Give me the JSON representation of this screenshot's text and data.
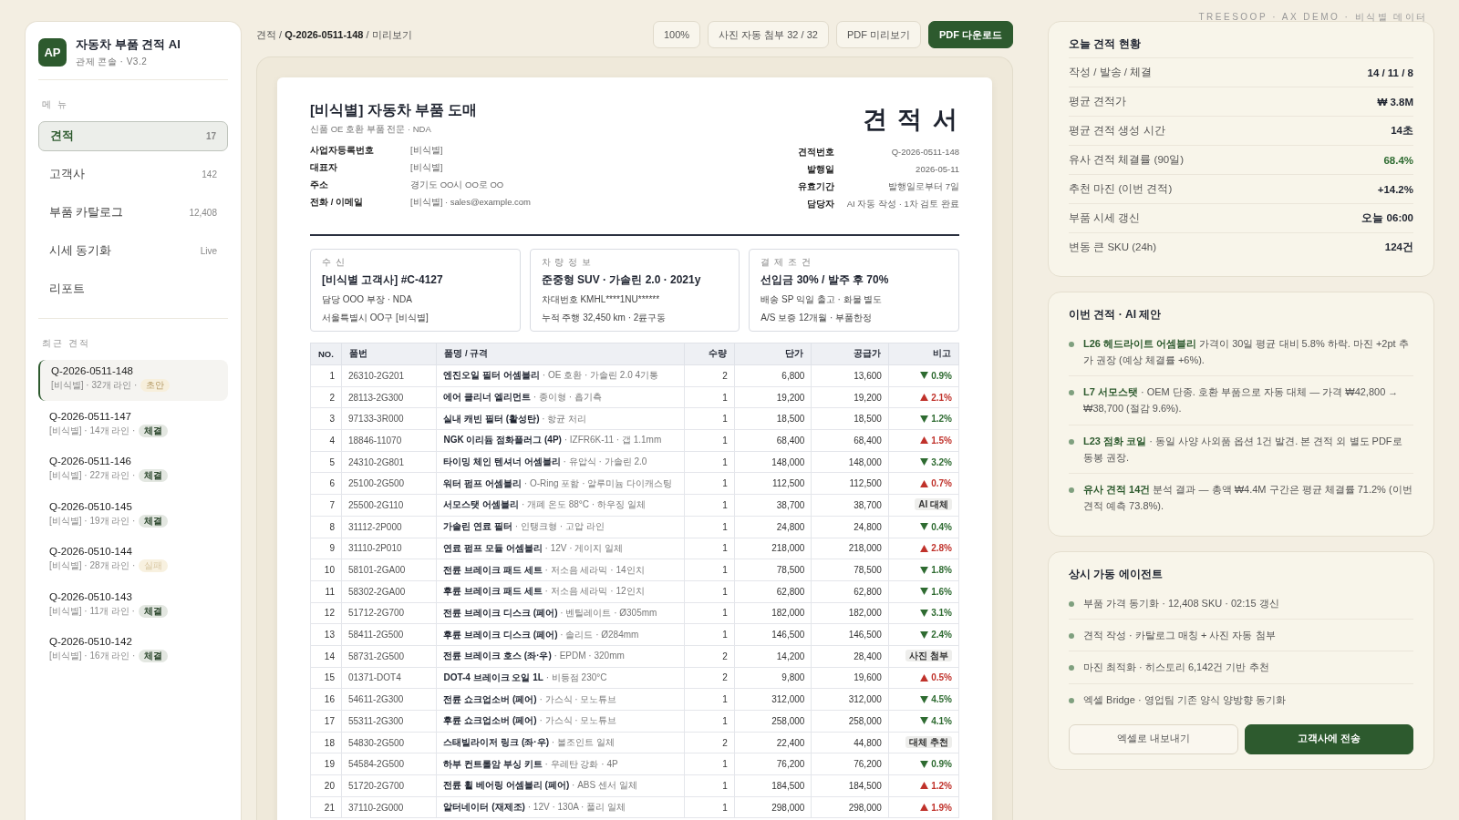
{
  "sidebar": {
    "logo": "AP",
    "app_name": "자동차 부품 견적 AI",
    "subtitle": "관제 콘솔 · V3.2",
    "menu_label": "메 뉴",
    "menu": [
      {
        "label": "견적",
        "count": "17",
        "selected": true
      },
      {
        "label": "고객사",
        "count": "142",
        "selected": false
      },
      {
        "label": "부품 카탈로그",
        "count": "12,408",
        "selected": false
      },
      {
        "label": "시세 동기화",
        "count": "Live",
        "selected": false
      },
      {
        "label": "리포트",
        "selected": false
      }
    ],
    "recent_label": "최근 견적",
    "recent": [
      {
        "id": "Q-2026-0511-148",
        "meta": "[비식별] · 32개 라인 ·",
        "status": "초안",
        "kind": "draft",
        "selected": true
      },
      {
        "id": "Q-2026-0511-147",
        "meta": "[비식별] · 14개 라인 ·",
        "status": "체결",
        "kind": "won",
        "selected": false
      },
      {
        "id": "Q-2026-0511-146",
        "meta": "[비식별] · 22개 라인 ·",
        "status": "체결",
        "kind": "won",
        "selected": false
      },
      {
        "id": "Q-2026-0510-145",
        "meta": "[비식별] · 19개 라인 ·",
        "status": "체결",
        "kind": "won",
        "selected": false
      },
      {
        "id": "Q-2026-0510-144",
        "meta": "[비식별] · 28개 라인 ·",
        "status": "실패",
        "kind": "lost",
        "selected": false
      },
      {
        "id": "Q-2026-0510-143",
        "meta": "[비식별] · 11개 라인 ·",
        "status": "체결",
        "kind": "won",
        "selected": false
      },
      {
        "id": "Q-2026-0510-142",
        "meta": "[비식별] · 16개 라인 ·",
        "status": "체결",
        "kind": "won",
        "selected": false
      }
    ]
  },
  "breadcrumb": "견적 / **Q-2026-0511-148** / 미리보기",
  "toolbar": [
    {
      "label": "100%",
      "kind": "plain"
    },
    {
      "label": "사진 자동 첨부 32 / 32",
      "kind": "plain"
    },
    {
      "label": "PDF 미리보기",
      "kind": "plain"
    },
    {
      "label": "PDF 다운로드",
      "kind": "primary"
    }
  ],
  "document": {
    "company": "[비식별] 자동차 부품 도매",
    "tagline": "신품 OE 호환 부품 전문 · NDA",
    "title": "견 적 서",
    "issuer": [
      {
        "label": "사업자등록번호",
        "value": "[비식별]"
      },
      {
        "label": "대표자",
        "value": "[비식별]"
      },
      {
        "label": "주소",
        "value": "경기도 OO시 OO로 OO"
      },
      {
        "label": "전화 / 이메일",
        "value": "[비식별] · sales@example.com"
      }
    ],
    "meta": [
      {
        "label": "견적번호",
        "value": "Q-2026-0511-148"
      },
      {
        "label": "발행일",
        "value": "2026-05-11"
      },
      {
        "label": "유효기간",
        "value": "발행일로부터 7일"
      },
      {
        "label": "담당자",
        "value": "AI 자동 작성 · 1차 검토 완료"
      }
    ],
    "boxes": [
      {
        "caption": "수 신",
        "lines": [
          "[비식별 고객사] #C-4127",
          "담당 OOO 부장 · NDA",
          "서울특별시 OO구 [비식별]"
        ]
      },
      {
        "caption": "차 량 정 보",
        "lines": [
          "준중형 SUV · 가솔린 2.0 · 2021y",
          "차대번호 KMHL****1NU******",
          "누적 주행 32,450 km · 2륜구동"
        ]
      },
      {
        "caption": "결 제 조 건",
        "lines": [
          "선입금 30% / 발주 후 70%",
          "배송 SP 익일 출고 · 화물 별도",
          "A/S 보증 12개월 · 부품한정"
        ]
      }
    ],
    "table": {
      "columns": [
        "NO.",
        "품번",
        "품명 / 규격",
        "수량",
        "단가",
        "공급가",
        "비고"
      ],
      "rows": [
        {
          "no": "1",
          "part": "26310-2G201",
          "name": "엔진오일 필터 어셈블리",
          "spec": "· OE 호환 · 가솔린 2.0 4기통",
          "qty": "2",
          "unit": "6,800",
          "total": "13,600",
          "note": {
            "kind": "down",
            "text": "0.9%"
          }
        },
        {
          "no": "2",
          "part": "28113-2G300",
          "name": "에어 클리너 엘리먼트",
          "spec": "· 종이형 · 흡기측",
          "qty": "1",
          "unit": "19,200",
          "total": "19,200",
          "note": {
            "kind": "up",
            "text": "2.1%"
          }
        },
        {
          "no": "3",
          "part": "97133-3R000",
          "name": "실내 캐빈 필터 (활성탄)",
          "spec": "· 항균 처리",
          "qty": "1",
          "unit": "18,500",
          "total": "18,500",
          "note": {
            "kind": "down",
            "text": "1.2%"
          }
        },
        {
          "no": "4",
          "part": "18846-11070",
          "name": "NGK 이리듐 점화플러그 (4P)",
          "spec": "· IZFR6K-11 · 갭 1.1mm",
          "qty": "1",
          "unit": "68,400",
          "total": "68,400",
          "note": {
            "kind": "up",
            "text": "1.5%"
          }
        },
        {
          "no": "5",
          "part": "24310-2G801",
          "name": "타이밍 체인 텐셔너 어셈블리",
          "spec": "· 유압식 · 가솔린 2.0",
          "qty": "1",
          "unit": "148,000",
          "total": "148,000",
          "note": {
            "kind": "down",
            "text": "3.2%"
          }
        },
        {
          "no": "6",
          "part": "25100-2G500",
          "name": "워터 펌프 어셈블리",
          "spec": "· O-Ring 포함 · 알루미늄 다이캐스팅",
          "qty": "1",
          "unit": "112,500",
          "total": "112,500",
          "note": {
            "kind": "up",
            "text": "0.7%"
          }
        },
        {
          "no": "7",
          "part": "25500-2G110",
          "name": "서모스탯 어셈블리",
          "spec": "· 개폐 온도 88°C · 하우징 일체",
          "qty": "1",
          "unit": "38,700",
          "total": "38,700",
          "note": {
            "kind": "tag",
            "text": "AI 대체"
          }
        },
        {
          "no": "8",
          "part": "31112-2P000",
          "name": "가솔린 연료 필터",
          "spec": "· 인탱크형 · 고압 라인",
          "qty": "1",
          "unit": "24,800",
          "total": "24,800",
          "note": {
            "kind": "down",
            "text": "0.4%"
          }
        },
        {
          "no": "9",
          "part": "31110-2P010",
          "name": "연료 펌프 모듈 어셈블리",
          "spec": "· 12V · 게이지 일체",
          "qty": "1",
          "unit": "218,000",
          "total": "218,000",
          "note": {
            "kind": "up",
            "text": "2.8%"
          }
        },
        {
          "no": "10",
          "part": "58101-2GA00",
          "name": "전륜 브레이크 패드 세트",
          "spec": "· 저소음 세라믹 · 14인치",
          "qty": "1",
          "unit": "78,500",
          "total": "78,500",
          "note": {
            "kind": "down",
            "text": "1.8%"
          }
        },
        {
          "no": "11",
          "part": "58302-2GA00",
          "name": "후륜 브레이크 패드 세트",
          "spec": "· 저소음 세라믹 · 12인치",
          "qty": "1",
          "unit": "62,800",
          "total": "62,800",
          "note": {
            "kind": "down",
            "text": "1.6%"
          }
        },
        {
          "no": "12",
          "part": "51712-2G700",
          "name": "전륜 브레이크 디스크 (페어)",
          "spec": "· 벤틸레이트 · Ø305mm",
          "qty": "1",
          "unit": "182,000",
          "total": "182,000",
          "note": {
            "kind": "down",
            "text": "3.1%"
          }
        },
        {
          "no": "13",
          "part": "58411-2G500",
          "name": "후륜 브레이크 디스크 (페어)",
          "spec": "· 솔리드 · Ø284mm",
          "qty": "1",
          "unit": "146,500",
          "total": "146,500",
          "note": {
            "kind": "down",
            "text": "2.4%"
          }
        },
        {
          "no": "14",
          "part": "58731-2G500",
          "name": "전륜 브레이크 호스 (좌·우)",
          "spec": "· EPDM · 320mm",
          "qty": "2",
          "unit": "14,200",
          "total": "28,400",
          "note": {
            "kind": "tag",
            "text": "사진 첨부"
          }
        },
        {
          "no": "15",
          "part": "01371-DOT4",
          "name": "DOT-4 브레이크 오일 1L",
          "spec": "· 비등점 230°C",
          "qty": "2",
          "unit": "9,800",
          "total": "19,600",
          "note": {
            "kind": "up",
            "text": "0.5%"
          }
        },
        {
          "no": "16",
          "part": "54611-2G300",
          "name": "전륜 쇼크업소버 (페어)",
          "spec": "· 가스식 · 모노튜브",
          "qty": "1",
          "unit": "312,000",
          "total": "312,000",
          "note": {
            "kind": "down",
            "text": "4.5%"
          }
        },
        {
          "no": "17",
          "part": "55311-2G300",
          "name": "후륜 쇼크업소버 (페어)",
          "spec": "· 가스식 · 모노튜브",
          "qty": "1",
          "unit": "258,000",
          "total": "258,000",
          "note": {
            "kind": "down",
            "text": "4.1%"
          }
        },
        {
          "no": "18",
          "part": "54830-2G500",
          "name": "스태빌라이저 링크 (좌·우)",
          "spec": "· 볼조인트 일체",
          "qty": "2",
          "unit": "22,400",
          "total": "44,800",
          "note": {
            "kind": "tag",
            "text": "대체 추천"
          }
        },
        {
          "no": "19",
          "part": "54584-2G500",
          "name": "하부 컨트롤암 부싱 키트",
          "spec": "· 우레탄 강화 · 4P",
          "qty": "1",
          "unit": "76,200",
          "total": "76,200",
          "note": {
            "kind": "down",
            "text": "0.9%"
          }
        },
        {
          "no": "20",
          "part": "51720-2G700",
          "name": "전륜 휠 베어링 어셈블리 (페어)",
          "spec": "· ABS 센서 일체",
          "qty": "1",
          "unit": "184,500",
          "total": "184,500",
          "note": {
            "kind": "up",
            "text": "1.2%"
          }
        },
        {
          "no": "21",
          "part": "37110-2G000",
          "name": "알터네이터 (재제조)",
          "spec": "· 12V · 130A · 풀리 일체",
          "qty": "1",
          "unit": "298,000",
          "total": "298,000",
          "note": {
            "kind": "up",
            "text": "1.9%"
          }
        }
      ]
    }
  },
  "brand_caption": "TREESOOP · AX DEMO · 비식별 데이터",
  "stats": {
    "title": "오늘 견적 현황",
    "rows": [
      {
        "label": "작성 / 발송 / 체결",
        "value": "14 / 11 / 8",
        "kind": "plain"
      },
      {
        "label": "평균 견적가",
        "value": "₩ 3.8M",
        "kind": "plain"
      },
      {
        "label": "평균 견적 생성 시간",
        "value": "14초",
        "kind": "plain"
      },
      {
        "label": "유사 견적 체결률 (90일)",
        "value": "68.4%",
        "kind": "good"
      },
      {
        "label": "추천 마진 (이번 견적)",
        "value": "+14.2%",
        "kind": "plain"
      },
      {
        "label": "부품 시세 갱신",
        "value": "오늘 06:00",
        "kind": "plain"
      },
      {
        "label": "변동 큰 SKU (24h)",
        "value": "124건",
        "kind": "plain"
      }
    ]
  },
  "suggestions": {
    "title": "이번 견적 · AI 제안",
    "items": [
      "**L26 헤드라이트 어셈블리** 가격이 30일 평균 대비 5.8% 하락. 마진 +2pt 추가 권장 (예상 체결률 +6%).",
      "**L7 서모스탯** · OEM 단종. 호환 부품으로 자동 대체 — 가격 ₩42,800 → ₩38,700 (절감 9.6%).",
      "**L23 점화 코일** · 동일 사양 사외품 옵션 1건 발견. 본 견적 외 별도 PDF로 동봉 권장.",
      "**유사 견적 14건** 분석 결과 — 총액 ₩4.4M 구간은 평균 체결률 71.2% (이번 견적 예측 73.8%)."
    ]
  },
  "agents": {
    "title": "상시 가동 에이전트",
    "items": [
      "부품 가격 동기화 · 12,408 SKU · 02:15 갱신",
      "견적 작성 · 카탈로그 매칭 + 사진 자동 첨부",
      "마진 최적화 · 히스토리 6,142건 기반 추천",
      "엑셀 Bridge · 영업팀 기존 양식 양방향 동기화"
    ],
    "buttons": [
      {
        "label": "엑셀로 내보내기",
        "kind": "secondary"
      },
      {
        "label": "고객사에 전송",
        "kind": "primary"
      }
    ]
  }
}
